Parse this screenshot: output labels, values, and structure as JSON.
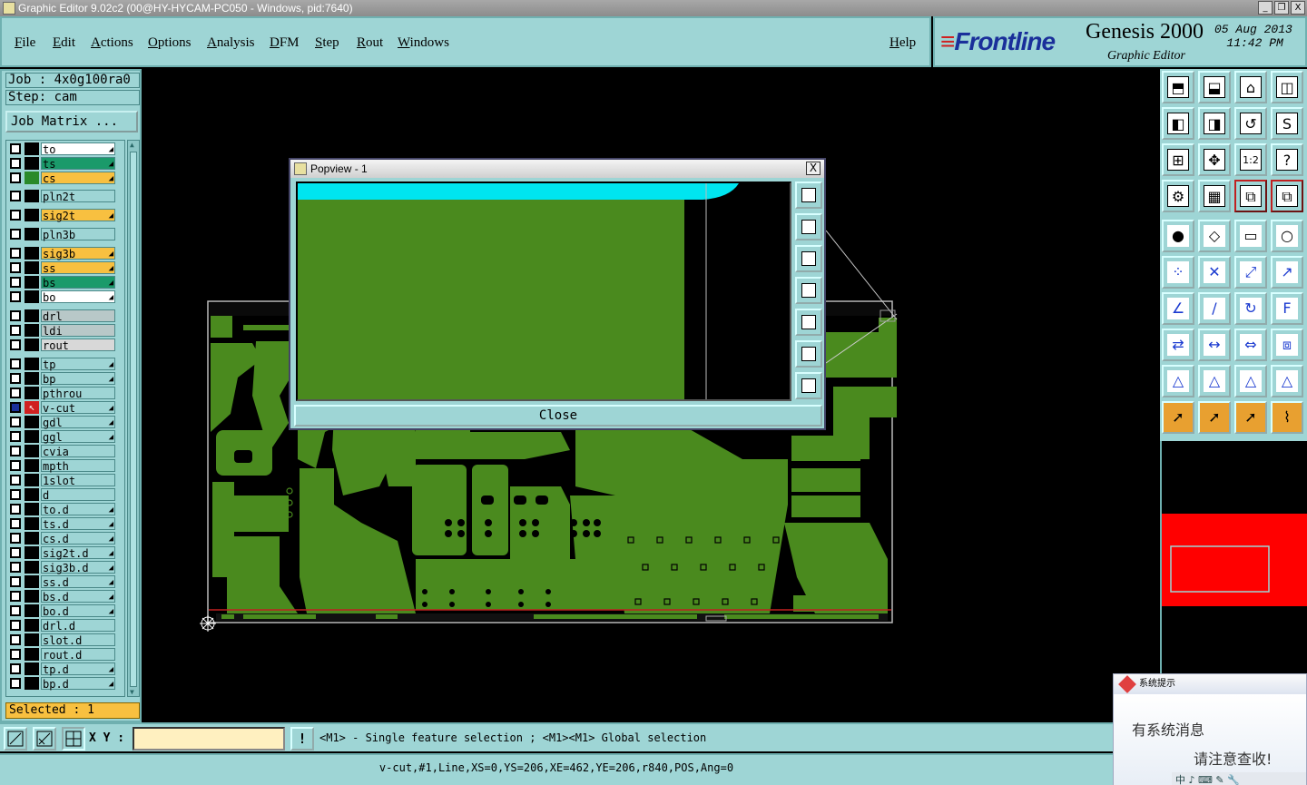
{
  "window": {
    "title": "Graphic Editor 9.02c2 (00@HY-HYCAM-PC050 - Windows, pid:7640)",
    "btn_min": "_",
    "btn_restore": "❐",
    "btn_close": "X"
  },
  "menu": [
    {
      "label": "File",
      "name": "menu-file"
    },
    {
      "label": "Edit",
      "name": "menu-edit"
    },
    {
      "label": "Actions",
      "name": "menu-actions"
    },
    {
      "label": "Options",
      "name": "menu-options"
    },
    {
      "label": "Analysis",
      "name": "menu-analysis"
    },
    {
      "label": "DFM",
      "name": "menu-dfm"
    },
    {
      "label": "Step",
      "name": "menu-step"
    },
    {
      "label": "Rout",
      "name": "menu-rout"
    },
    {
      "label": "Windows",
      "name": "menu-windows"
    }
  ],
  "help_label": "Help",
  "brand": {
    "logo": "Frontline",
    "logo_mark": "≡",
    "product": "Genesis 2000",
    "subtitle": "Graphic Editor",
    "date": "05 Aug 2013",
    "time": "11:42 PM"
  },
  "job": {
    "job_line": "Job : 4x0g100ra0",
    "step_line": "Step: cam",
    "matrix_label": "Job Matrix ..."
  },
  "layers": [
    {
      "name": "to",
      "bg": "#ffffff",
      "swatch": "#000000",
      "arrow": true
    },
    {
      "name": "ts",
      "bg": "#1a9a6a",
      "swatch": "#000000",
      "arrow": true
    },
    {
      "name": "cs",
      "bg": "#f8c040",
      "swatch": "#2a8a2a",
      "arrow": true
    },
    {
      "name": "pln2t",
      "bg": "#9ed5d5",
      "swatch": "#000000",
      "arrow": false
    },
    {
      "name": "sig2t",
      "bg": "#f8c040",
      "swatch": "#000000",
      "arrow": true
    },
    {
      "name": "pln3b",
      "bg": "#9ed5d5",
      "swatch": "#000000",
      "arrow": false
    },
    {
      "name": "sig3b",
      "bg": "#f8c040",
      "swatch": "#000000",
      "arrow": true
    },
    {
      "name": "ss",
      "bg": "#f8c040",
      "swatch": "#000000",
      "arrow": true
    },
    {
      "name": "bs",
      "bg": "#1a9a6a",
      "swatch": "#000000",
      "arrow": true
    },
    {
      "name": "bo",
      "bg": "#ffffff",
      "swatch": "#000000",
      "arrow": true
    },
    {
      "name": "drl",
      "bg": "#b8c8c8",
      "swatch": "#000000",
      "arrow": false
    },
    {
      "name": "ldi",
      "bg": "#b8c8c8",
      "swatch": "#000000",
      "arrow": false
    },
    {
      "name": "rout",
      "bg": "#d8d8d8",
      "swatch": "#000000",
      "arrow": false
    },
    {
      "name": "tp",
      "bg": "#9ed5d5",
      "swatch": "#000000",
      "arrow": true
    },
    {
      "name": "bp",
      "bg": "#9ed5d5",
      "swatch": "#000000",
      "arrow": true
    },
    {
      "name": "pthrou",
      "bg": "#9ed5d5",
      "swatch": "#000000",
      "arrow": false
    },
    {
      "name": "v-cut",
      "bg": "#9ed5d5",
      "swatch": "#d02020",
      "arrow": true,
      "active": true
    },
    {
      "name": "gdl",
      "bg": "#9ed5d5",
      "swatch": "#000000",
      "arrow": true
    },
    {
      "name": "ggl",
      "bg": "#9ed5d5",
      "swatch": "#000000",
      "arrow": true
    },
    {
      "name": "cvia",
      "bg": "#9ed5d5",
      "swatch": "#000000",
      "arrow": false
    },
    {
      "name": "mpth",
      "bg": "#9ed5d5",
      "swatch": "#000000",
      "arrow": false
    },
    {
      "name": "1slot",
      "bg": "#9ed5d5",
      "swatch": "#000000",
      "arrow": false
    },
    {
      "name": "d",
      "bg": "#9ed5d5",
      "swatch": "#000000",
      "arrow": false
    },
    {
      "name": "to.d",
      "bg": "#9ed5d5",
      "swatch": "#000000",
      "arrow": true
    },
    {
      "name": "ts.d",
      "bg": "#9ed5d5",
      "swatch": "#000000",
      "arrow": true
    },
    {
      "name": "cs.d",
      "bg": "#9ed5d5",
      "swatch": "#000000",
      "arrow": true
    },
    {
      "name": "sig2t.d",
      "bg": "#9ed5d5",
      "swatch": "#000000",
      "arrow": true
    },
    {
      "name": "sig3b.d",
      "bg": "#9ed5d5",
      "swatch": "#000000",
      "arrow": true
    },
    {
      "name": "ss.d",
      "bg": "#9ed5d5",
      "swatch": "#000000",
      "arrow": true
    },
    {
      "name": "bs.d",
      "bg": "#9ed5d5",
      "swatch": "#000000",
      "arrow": true
    },
    {
      "name": "bo.d",
      "bg": "#9ed5d5",
      "swatch": "#000000",
      "arrow": true
    },
    {
      "name": "drl.d",
      "bg": "#9ed5d5",
      "swatch": "#000000",
      "arrow": false
    },
    {
      "name": "slot.d",
      "bg": "#9ed5d5",
      "swatch": "#000000",
      "arrow": false
    },
    {
      "name": "rout.d",
      "bg": "#9ed5d5",
      "swatch": "#000000",
      "arrow": false
    },
    {
      "name": "tp.d",
      "bg": "#9ed5d5",
      "swatch": "#000000",
      "arrow": true
    },
    {
      "name": "bp.d",
      "bg": "#9ed5d5",
      "swatch": "#000000",
      "arrow": true
    }
  ],
  "selected_label": "Selected : 1",
  "xy_label": "X Y :",
  "xy_value": "",
  "excl_label": "!",
  "prompt": "<M1> - Single feature selection ; <M1><M1> Global selection",
  "status": "v-cut,#1,Line,XS=0,YS=206,XE=462,YE=206,r840,POS,Ang=0",
  "popview": {
    "title": "Popview - 1",
    "close_label": "Close",
    "close_x": "X"
  },
  "notification": {
    "title": "系统提示",
    "line1": "有系统消息",
    "line2": "请注意查收!",
    "tray": "中 ♪ ⌨ ✎ 🔧"
  },
  "toolbar_icons": [
    "zoom-home-icon",
    "zoom-home-icon",
    "home-icon",
    "split-view-icon",
    "pan-left-icon",
    "pan-right-icon",
    "undo-view-icon",
    "redraw-icon",
    "fit-icon",
    "center-icon",
    "scale-1-2-icon",
    "help-icon",
    "settings-icon",
    "grid-icon",
    "layer-display-icon",
    "layer-display-icon",
    "add-pad-icon",
    "add-surface-icon",
    "measure-icon",
    "add-hole-icon",
    "connect-icon",
    "cross-icon",
    "add-arc-icon",
    "add-node-icon",
    "angle-icon",
    "line-icon",
    "arc-icon",
    "text-icon",
    "move-icon",
    "cut-icon",
    "resize-icon",
    "copy-icon",
    "snap-icon",
    "snap-center-icon",
    "snap-edge-icon",
    "snap-skel-icon",
    "select-icon",
    "select-box-icon",
    "select-cursor-icon",
    "select-net-icon"
  ],
  "pop_tools": [
    "zoom-in-icon",
    "zoom-out-icon",
    "pan-up-icon",
    "pan-left-icon",
    "pan-right-icon",
    "zoom-fit-icon",
    "center-icon"
  ],
  "colors": {
    "board": "#4a8a1e",
    "panel": "#9ed5d5",
    "accent": "#f8c040",
    "cyan": "#00e5f0"
  }
}
